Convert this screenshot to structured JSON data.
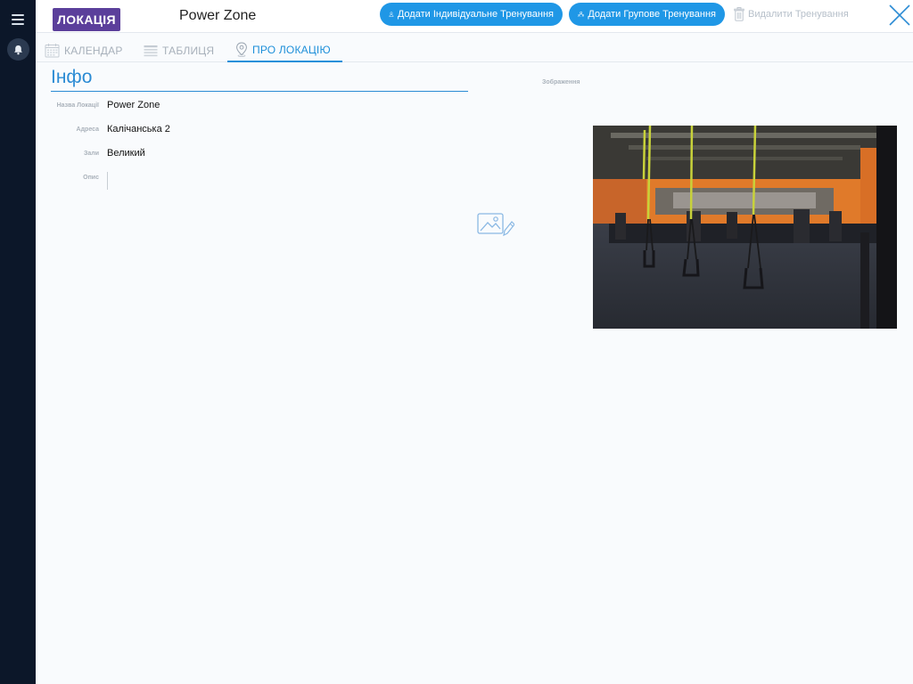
{
  "header": {
    "badge": "ЛОКАЦІЯ",
    "title": "Power Zone",
    "add_individual": "Додати Індивідуальне Тренування",
    "add_group": "Додати Групове Тренування",
    "delete": "Видалити Тренування"
  },
  "tabs": [
    {
      "label": "КАЛЕНДАР",
      "icon": "calendar-icon",
      "active": false
    },
    {
      "label": "ТАБЛИЦЯ",
      "icon": "table-icon",
      "active": false
    },
    {
      "label": "ПРО ЛОКАЦІЮ",
      "icon": "location-pin-icon",
      "active": true
    }
  ],
  "info": {
    "heading": "Інфо",
    "fields": [
      {
        "label": "Назва Локації",
        "value": "Power Zone"
      },
      {
        "label": "Адреса",
        "value": "Калічанська 2"
      },
      {
        "label": "Зали",
        "value": "Великий"
      },
      {
        "label": "Опис",
        "value": ""
      }
    ]
  },
  "image": {
    "label": "Зображення",
    "edit_icon": "image-edit-icon",
    "photo_icon": "gym-photo"
  },
  "colors": {
    "sidebar": "#0c1729",
    "badge": "#5b3f9b",
    "accent": "#1f97e6",
    "heading": "#2b8bd4",
    "muted": "#aab2bb"
  }
}
